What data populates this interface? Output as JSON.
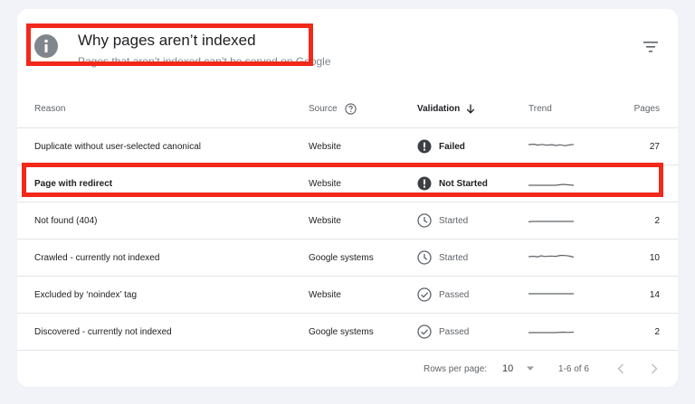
{
  "header": {
    "title": "Why pages aren’t indexed",
    "subtitle": "Pages that aren’t indexed can’t be served on Google",
    "info_icon": "info-icon",
    "filter_icon": "filter-icon"
  },
  "table": {
    "columns": {
      "reason": "Reason",
      "source": "Source",
      "validation": "Validation",
      "trend": "Trend",
      "pages": "Pages"
    },
    "rows": [
      {
        "reason": "Duplicate without user-selected canonical",
        "source": "Website",
        "validation": "Failed",
        "validation_icon": "alert-icon",
        "pages": "27"
      },
      {
        "reason": "Page with redirect",
        "source": "Website",
        "validation": "Not Started",
        "validation_icon": "alert-icon",
        "pages": ""
      },
      {
        "reason": "Not found (404)",
        "source": "Website",
        "validation": "Started",
        "validation_icon": "clock-icon",
        "pages": "2"
      },
      {
        "reason": "Crawled - currently not indexed",
        "source": "Google systems",
        "validation": "Started",
        "validation_icon": "clock-icon",
        "pages": "10"
      },
      {
        "reason": "Excluded by ‘noindex’ tag",
        "source": "Website",
        "validation": "Passed",
        "validation_icon": "check-circle-icon",
        "pages": "14"
      },
      {
        "reason": "Discovered - currently not indexed",
        "source": "Google systems",
        "validation": "Passed",
        "validation_icon": "check-circle-icon",
        "pages": "2"
      }
    ]
  },
  "footer": {
    "rows_per_page_label": "Rows per page:",
    "rows_per_page_value": "10",
    "range": "1-6 of 6"
  },
  "colors": {
    "highlight": "#f2281b",
    "background": "#f1f3f9",
    "icon_grey": "#5f6368"
  }
}
